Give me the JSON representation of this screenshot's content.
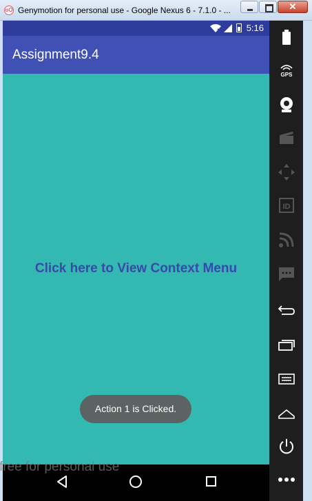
{
  "window": {
    "title": "Genymotion for personal use - Google Nexus 6 - 7.1.0 - ...",
    "app_icon": "genymotion-logo-icon"
  },
  "status_bar": {
    "time": "5:16"
  },
  "app_bar": {
    "title": "Assignment9.4"
  },
  "content": {
    "link_text": "Click here to View Context Menu"
  },
  "toast": {
    "text": "Action 1 is Clicked."
  },
  "watermark": "free for personal use",
  "sidebar": {
    "items": [
      {
        "name": "battery-icon",
        "label": ""
      },
      {
        "name": "gps-icon",
        "label": "GPS"
      },
      {
        "name": "webcam-icon",
        "label": ""
      },
      {
        "name": "media-icon",
        "label": ""
      },
      {
        "name": "dpad-icon",
        "label": ""
      },
      {
        "name": "identifiers-icon",
        "label": "ID"
      },
      {
        "name": "network-icon",
        "label": ""
      },
      {
        "name": "sms-icon",
        "label": ""
      },
      {
        "name": "back-icon",
        "label": ""
      },
      {
        "name": "recent-apps-icon",
        "label": ""
      },
      {
        "name": "menu-icon",
        "label": ""
      },
      {
        "name": "home-icon",
        "label": ""
      },
      {
        "name": "power-icon",
        "label": ""
      },
      {
        "name": "more-icon",
        "label": ""
      }
    ]
  },
  "colors": {
    "status_bar": "#2e3d9d",
    "app_bar": "#3f51b5",
    "content_bg": "#33b9b1",
    "link": "#3949ab",
    "toast_bg": "#5b6462"
  }
}
